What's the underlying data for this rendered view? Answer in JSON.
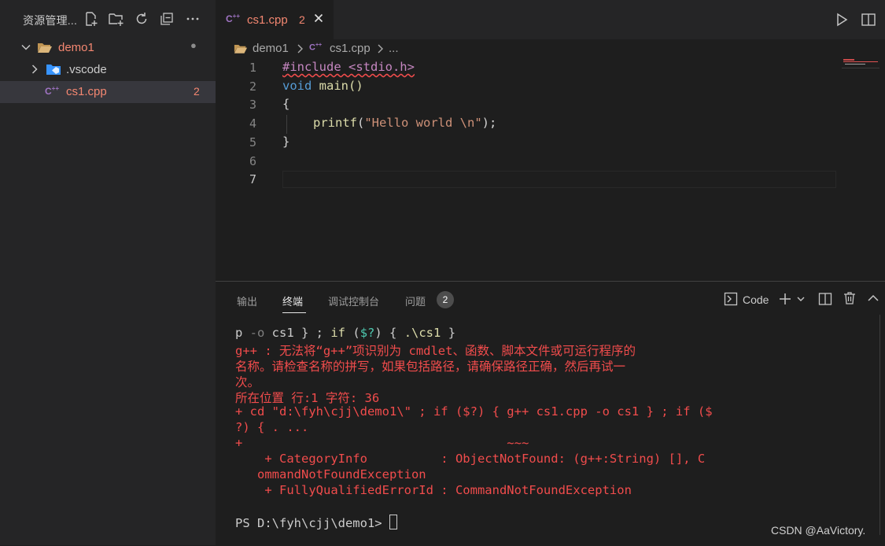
{
  "sidebar": {
    "title": "资源管理...",
    "tree": [
      {
        "label": "demo1",
        "badge": "●"
      },
      {
        "label": ".vscode"
      },
      {
        "label": "cs1.cpp",
        "badge": "2"
      }
    ]
  },
  "editor": {
    "tab": {
      "label": "cs1.cpp",
      "problems": "2"
    },
    "breadcrumb": {
      "folder": "demo1",
      "file": "cs1.cpp",
      "more": "..."
    },
    "lines": [
      {
        "num": "1",
        "text": "#include <stdio.h>"
      },
      {
        "num": "2",
        "kw": "void",
        "text": " main()"
      },
      {
        "num": "3",
        "text": "{"
      },
      {
        "num": "4",
        "fn": "printf",
        "str": "\"Hello world \\n\"",
        "text": ");"
      },
      {
        "num": "5",
        "text": "}"
      },
      {
        "num": "6",
        "text": ""
      },
      {
        "num": "7",
        "text": ""
      }
    ]
  },
  "panel": {
    "tabs": [
      "输出",
      "终端",
      "调试控制台",
      "问题"
    ],
    "problems_count": "2",
    "terminal_name": "Code",
    "terminal": {
      "line1": [
        "p ",
        "-o",
        " cs1 } ; ",
        "if",
        " (",
        "$?",
        ") { ",
        ".\\cs1",
        " }"
      ],
      "error_lines": [
        "g++ : 无法将“g++”项识别为 cmdlet、函数、脚本文件或可运行程序的",
        "名称。请检查名称的拼写，如果包括路径，请确保路径正确，然后再试一",
        "次。",
        "所在位置 行:1 字符: 36",
        "+ cd \"d:\\fyh\\cjj\\demo1\\\" ; if ($?) { g++ cs1.cpp -o cs1 } ; if ($",
        "?) { . ...",
        "+                                    ~~~",
        "    + CategoryInfo          : ObjectNotFound: (g++:String) [], C",
        "   ommandNotFoundException",
        "    + FullyQualifiedErrorId : CommandNotFoundException"
      ],
      "prompt": "PS D:\\fyh\\cjj\\demo1> "
    }
  },
  "watermark": "CSDN @AaVictory."
}
